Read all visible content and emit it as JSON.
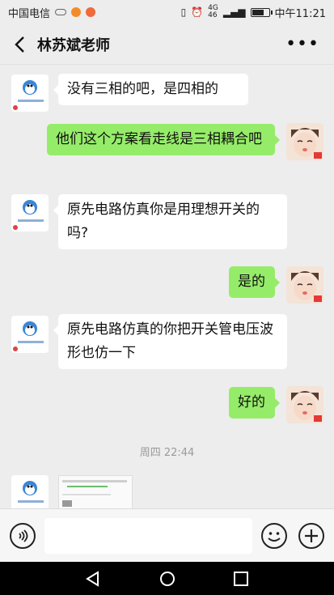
{
  "status_bar": {
    "carrier": "中国电信",
    "network_labels": [
      "4G",
      "46"
    ],
    "time": "中午11:21"
  },
  "header": {
    "title": "林苏斌老师"
  },
  "messages": [
    {
      "side": "in",
      "text": "没有三相的吧，是四相的"
    },
    {
      "side": "out",
      "text": "他们这个方案看走线是三相耦合吧"
    },
    {
      "side": "in",
      "text": "原先电路仿真你是用理想开关的吗?"
    },
    {
      "side": "out",
      "text": "是的"
    },
    {
      "side": "in",
      "text": "原先电路仿真的你把开关管电压波形也仿一下"
    },
    {
      "side": "out",
      "text": "好的"
    }
  ],
  "timestamp": "周四 22:44",
  "input": {
    "placeholder": ""
  },
  "colors": {
    "background": "#ededed",
    "outgoing_bubble": "#95ec69",
    "incoming_bubble": "#ffffff"
  },
  "icons": [
    "back-arrow-icon",
    "more-icon",
    "voice-icon",
    "emoji-icon",
    "plus-icon",
    "nav-back-icon",
    "nav-home-icon",
    "nav-recent-icon"
  ]
}
